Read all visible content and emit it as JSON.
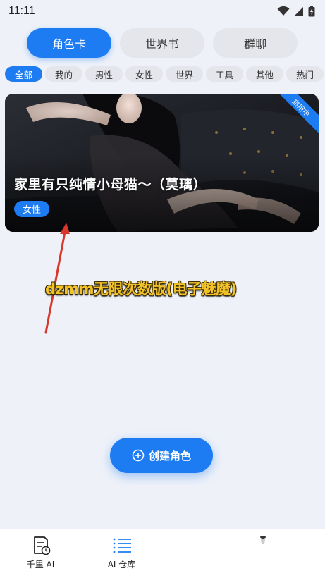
{
  "status_bar": {
    "time": "11:11"
  },
  "main_tabs": [
    {
      "label": "角色卡",
      "active": true
    },
    {
      "label": "世界书",
      "active": false
    },
    {
      "label": "群聊",
      "active": false
    }
  ],
  "filters": [
    {
      "label": "全部",
      "active": true
    },
    {
      "label": "我的",
      "active": false
    },
    {
      "label": "男性",
      "active": false
    },
    {
      "label": "女性",
      "active": false
    },
    {
      "label": "世界",
      "active": false
    },
    {
      "label": "工具",
      "active": false
    },
    {
      "label": "其他",
      "active": false
    },
    {
      "label": "热门",
      "active": false
    }
  ],
  "card": {
    "title": "家里有只纯情小母猫～（莫璃）",
    "tag": "女性",
    "ribbon": "启用中"
  },
  "annotation": {
    "text": "dzmm无限次数版(电子魅魔)"
  },
  "create_button": {
    "label": "创建角色"
  },
  "bottom_nav": [
    {
      "label": "千里 AI",
      "icon": "document-clock-icon"
    },
    {
      "label": "AI 仓库",
      "icon": "list-icon"
    }
  ],
  "colors": {
    "accent": "#1e7cf2",
    "background": "#eef1f8",
    "annotation": "#f2c229"
  }
}
